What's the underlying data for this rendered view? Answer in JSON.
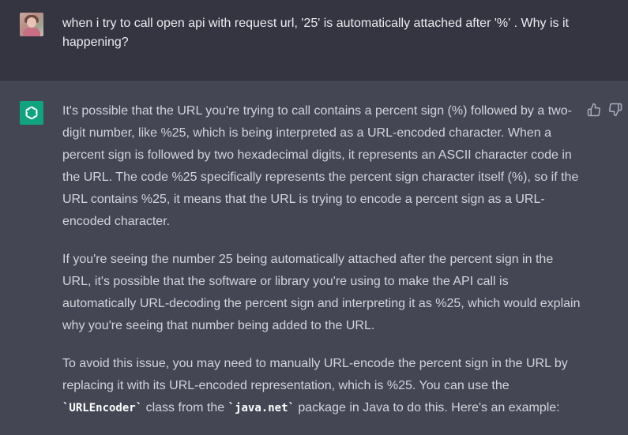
{
  "user_message": {
    "text": "when i try to call open api with request url, '25' is automatically attached after '%' . Why is it happening?"
  },
  "assistant_message": {
    "p1": "It's possible that the URL you're trying to call contains a percent sign (%) followed by a two-digit number, like %25, which is being interpreted as a URL-encoded character. When a percent sign is followed by two hexadecimal digits, it represents an ASCII character code in the URL. The code %25 specifically represents the percent sign character itself (%), so if the URL contains %25, it means that the URL is trying to encode a percent sign as a URL-encoded character.",
    "p2": "If you're seeing the number 25 being automatically attached after the percent sign in the URL, it's possible that the software or library you're using to make the API call is automatically URL-decoding the percent sign and interpreting it as %25, which would explain why you're seeing that number being added to the URL.",
    "p3_before": "To avoid this issue, you may need to manually URL-encode the percent sign in the URL by replacing it with its URL-encoded representation, which is %25. You can use the ",
    "p3_code1": "`URLEncoder`",
    "p3_mid": " class from the ",
    "p3_code2": "`java.net`",
    "p3_after": " package in Java to do this. Here's an example:"
  },
  "icons": {
    "user_avatar": "user-avatar",
    "assistant_avatar": "openai-logo-icon",
    "feedback_up": "thumbs-up-icon",
    "feedback_down": "thumbs-down-icon"
  },
  "colors": {
    "user_bg": "#343541",
    "assistant_bg": "#444654",
    "brand": "#10a37f"
  }
}
